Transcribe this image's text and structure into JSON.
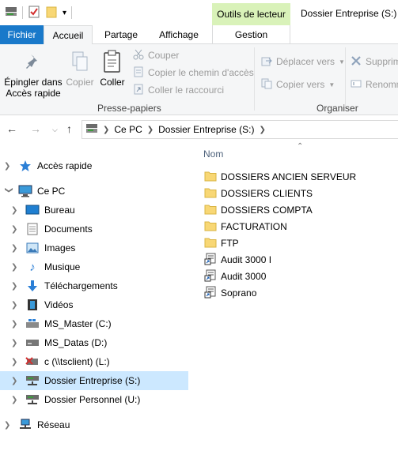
{
  "titlebar": {
    "contextual_tab": "Outils de lecteur",
    "window_title": "Dossier Entreprise (S:)"
  },
  "tabs": {
    "fichier": "Fichier",
    "accueil": "Accueil",
    "partage": "Partage",
    "affichage": "Affichage",
    "gestion": "Gestion"
  },
  "ribbon": {
    "pin": "Épingler dans Accès rapide",
    "copy": "Copier",
    "paste": "Coller",
    "cut": "Couper",
    "copy_path": "Copier le chemin d'accès",
    "paste_shortcut": "Coller le raccourci",
    "group_clipboard": "Presse-papiers",
    "move_to": "Déplacer vers",
    "copy_to": "Copier vers",
    "delete": "Supprim",
    "rename": "Renomm",
    "group_organize": "Organiser"
  },
  "address": {
    "crumbs": [
      "Ce PC",
      "Dossier Entreprise (S:)"
    ]
  },
  "nav": {
    "quick_access": "Accès rapide",
    "this_pc": "Ce PC",
    "desktop": "Bureau",
    "documents": "Documents",
    "images": "Images",
    "music": "Musique",
    "downloads": "Téléchargements",
    "videos": "Vidéos",
    "drive_c": "MS_Master (C:)",
    "drive_d": "MS_Datas (D:)",
    "drive_l": "c (\\\\tsclient) (L:)",
    "drive_s": "Dossier Entreprise (S:)",
    "drive_u": "Dossier Personnel (U:)",
    "network": "Réseau"
  },
  "content": {
    "column_name": "Nom",
    "items": [
      {
        "name": "DOSSIERS ANCIEN SERVEUR",
        "type": "folder"
      },
      {
        "name": "DOSSIERS CLIENTS",
        "type": "folder"
      },
      {
        "name": "DOSSIERS COMPTA",
        "type": "folder"
      },
      {
        "name": "FACTURATION",
        "type": "folder"
      },
      {
        "name": "FTP",
        "type": "folder"
      },
      {
        "name": "Audit 3000 I",
        "type": "shortcut"
      },
      {
        "name": "Audit 3000",
        "type": "shortcut"
      },
      {
        "name": "Soprano",
        "type": "shortcut"
      }
    ]
  },
  "colors": {
    "accent": "#1979ca",
    "selection": "#cce8ff",
    "contextual_tab": "#d9f2b9",
    "folder": "#f8d775"
  }
}
